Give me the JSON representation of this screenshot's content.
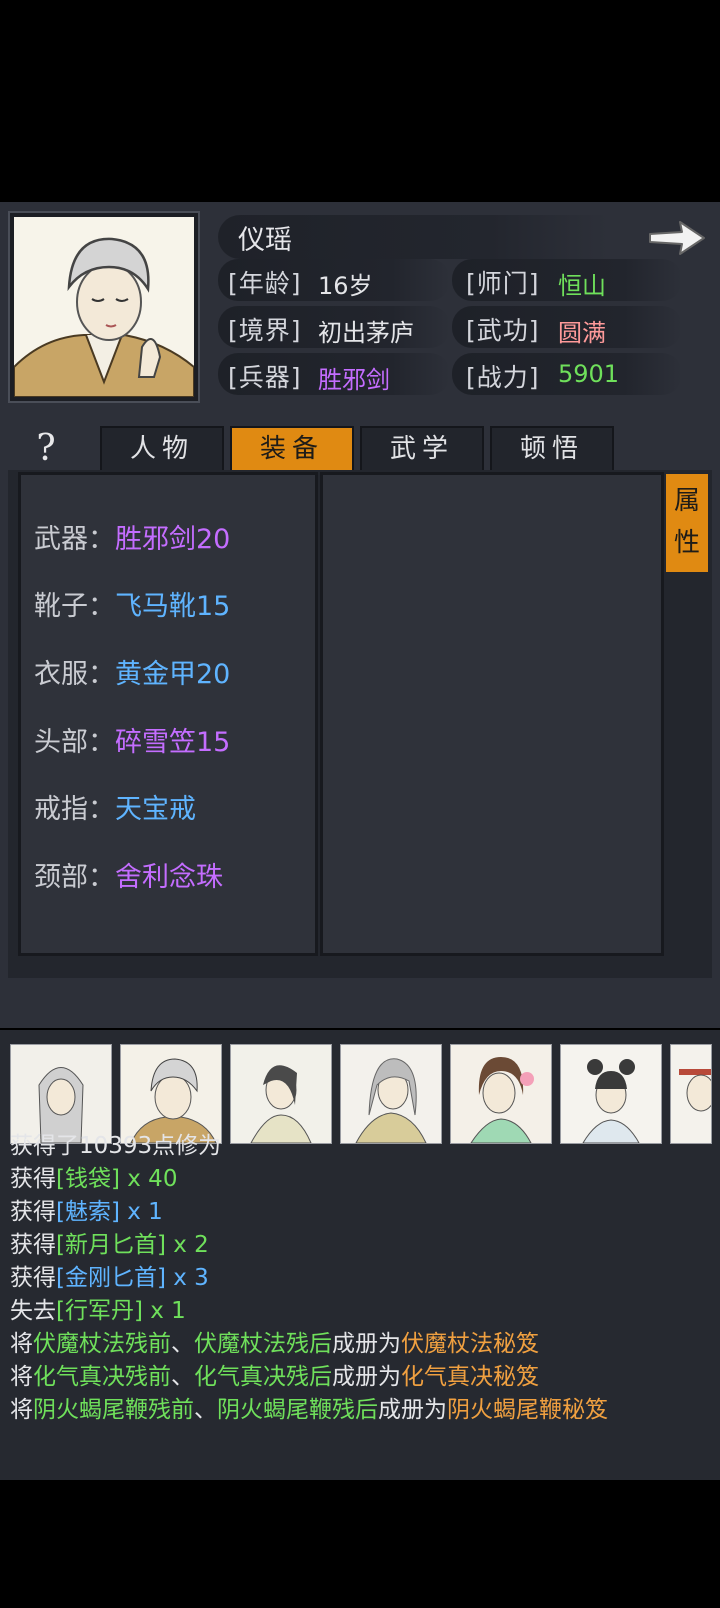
{
  "character": {
    "name": "仪瑶",
    "info": [
      {
        "label": "[年龄]",
        "value": "16岁",
        "color": "#e4e5e8"
      },
      {
        "label": "[师门]",
        "value": "恒山",
        "color": "#6fe05b"
      },
      {
        "label": "[境界]",
        "value": "初出茅庐",
        "color": "#e4e5e8"
      },
      {
        "label": "[武功]",
        "value": "圆满",
        "color": "#ff9a9a"
      },
      {
        "label": "[兵器]",
        "value": "胜邪剑",
        "color": "#c46dff"
      },
      {
        "label": "[战力]",
        "value": "5901",
        "color": "#6fe05b"
      }
    ]
  },
  "help_glyph": "?",
  "tabs": [
    {
      "label": "人物",
      "active": false
    },
    {
      "label": "装备",
      "active": true
    },
    {
      "label": "武学",
      "active": false
    },
    {
      "label": "顿悟",
      "active": false
    }
  ],
  "attr_button": {
    "line1": "属",
    "line2": "性"
  },
  "equipment": [
    {
      "label": "武器：",
      "item": "胜邪剑20",
      "color": "#c46dff"
    },
    {
      "label": "靴子：",
      "item": "飞马靴15",
      "color": "#5fb4ff"
    },
    {
      "label": "衣服：",
      "item": "黄金甲20",
      "color": "#5fb4ff"
    },
    {
      "label": "头部：",
      "item": "碎雪笠15",
      "color": "#c46dff"
    },
    {
      "label": "戒指：",
      "item": "天宝戒",
      "color": "#5fb4ff"
    },
    {
      "label": "颈部：",
      "item": "舍利念珠",
      "color": "#c46dff"
    }
  ],
  "party_count": 7,
  "log": [
    {
      "parts": [
        {
          "t": "获得了10393点修为",
          "c": ""
        }
      ]
    },
    {
      "parts": [
        {
          "t": "获得",
          "c": ""
        },
        {
          "t": "[钱袋]",
          "c": "g"
        },
        {
          "t": " x 40",
          "c": "g"
        }
      ]
    },
    {
      "parts": [
        {
          "t": "获得",
          "c": ""
        },
        {
          "t": "[魅索]",
          "c": "b"
        },
        {
          "t": " x 1",
          "c": "b"
        }
      ]
    },
    {
      "parts": [
        {
          "t": "获得",
          "c": ""
        },
        {
          "t": "[新月匕首]",
          "c": "g"
        },
        {
          "t": " x 2",
          "c": "g"
        }
      ]
    },
    {
      "parts": [
        {
          "t": "获得",
          "c": ""
        },
        {
          "t": "[金刚匕首]",
          "c": "b"
        },
        {
          "t": " x 3",
          "c": "b"
        }
      ]
    },
    {
      "parts": [
        {
          "t": "失去",
          "c": ""
        },
        {
          "t": "[行军丹]",
          "c": "g"
        },
        {
          "t": " x 1",
          "c": "g"
        }
      ]
    },
    {
      "parts": [
        {
          "t": "将",
          "c": ""
        },
        {
          "t": "伏魔杖法残前",
          "c": "g"
        },
        {
          "t": "、",
          "c": ""
        },
        {
          "t": "伏魔杖法残后",
          "c": "g"
        },
        {
          "t": "成册为",
          "c": ""
        },
        {
          "t": "伏魔杖法秘笈",
          "c": "o"
        }
      ]
    },
    {
      "parts": [
        {
          "t": "将",
          "c": ""
        },
        {
          "t": "化气真决残前",
          "c": "g"
        },
        {
          "t": "、",
          "c": ""
        },
        {
          "t": "化气真决残后",
          "c": "g"
        },
        {
          "t": "成册为",
          "c": ""
        },
        {
          "t": "化气真决秘笈",
          "c": "o"
        }
      ]
    },
    {
      "parts": [
        {
          "t": "将",
          "c": ""
        },
        {
          "t": "阴火蝎尾鞭残前",
          "c": "g"
        },
        {
          "t": "、",
          "c": ""
        },
        {
          "t": "阴火蝎尾鞭残后",
          "c": "g"
        },
        {
          "t": "成册为",
          "c": ""
        },
        {
          "t": "阴火蝎尾鞭秘笈",
          "c": "o"
        }
      ]
    }
  ]
}
